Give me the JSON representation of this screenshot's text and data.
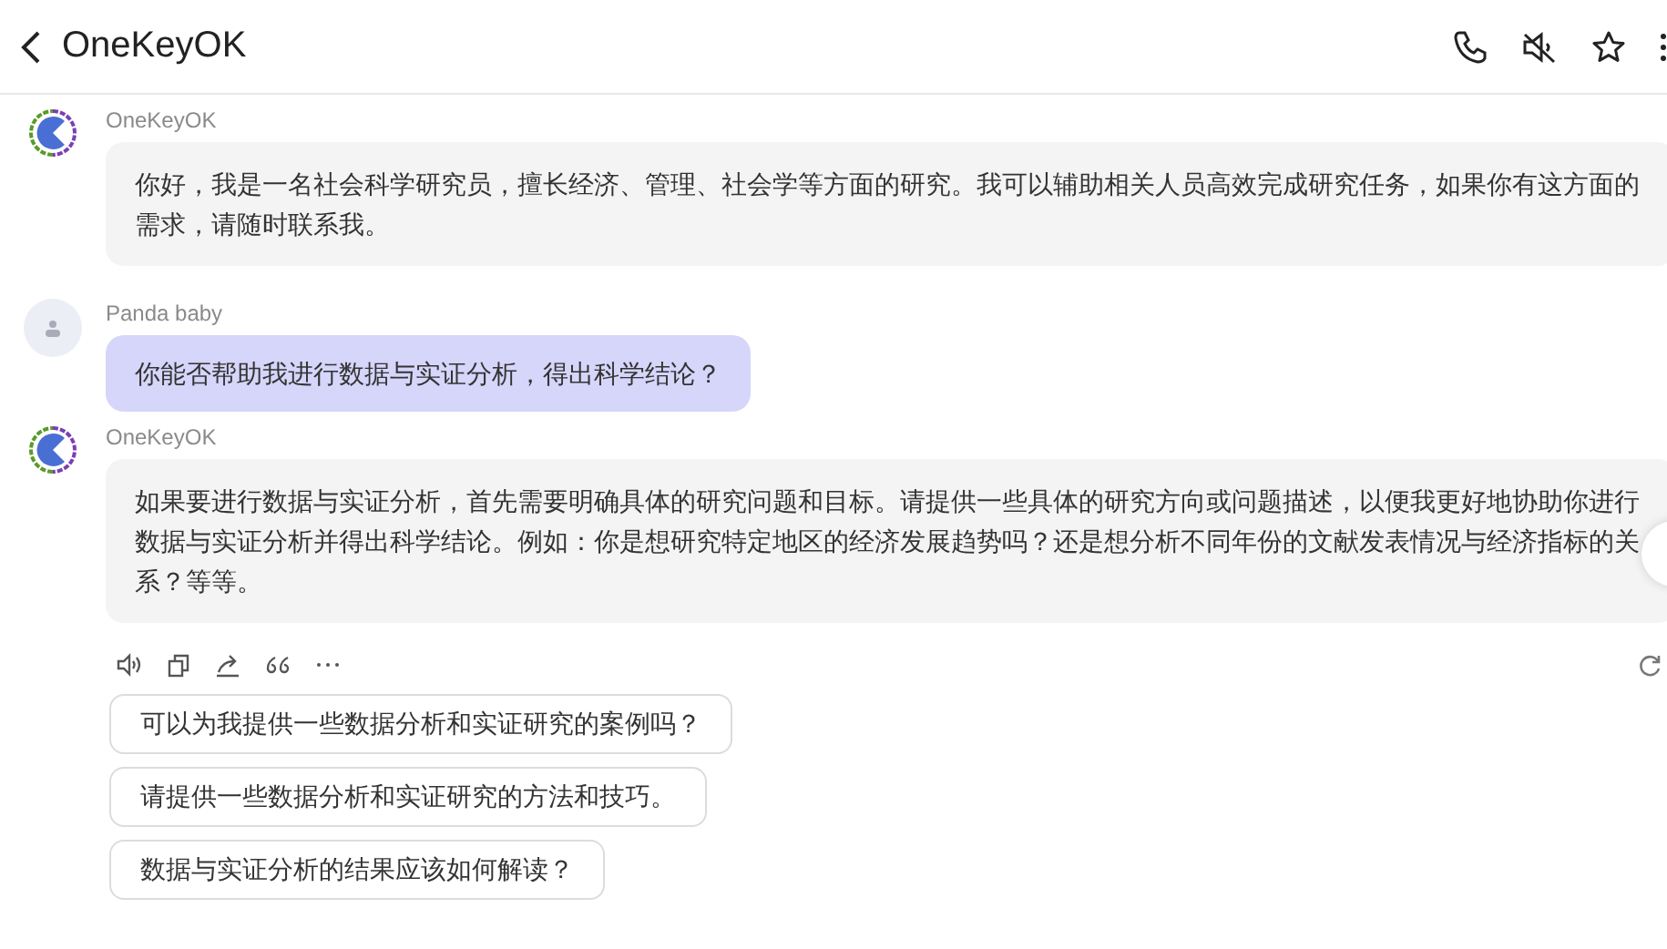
{
  "header": {
    "title": "OneKeyOK"
  },
  "messages": [
    {
      "kind": "bot",
      "sender": "OneKeyOK",
      "text": "你好，我是一名社会科学研究员，擅长经济、管理、社会学等方面的研究。我可以辅助相关人员高效完成研究任务，如果你有这方面的需求，请随时联系我。"
    },
    {
      "kind": "user",
      "sender": "Panda baby",
      "text": "你能否帮助我进行数据与实证分析，得出科学结论？"
    },
    {
      "kind": "bot",
      "sender": "OneKeyOK",
      "text": "如果要进行数据与实证分析，首先需要明确具体的研究问题和目标。请提供一些具体的研究方向或问题描述，以便我更好地协助你进行数据与实证分析并得出科学结论。例如：你是想研究特定地区的经济发展趋势吗？还是想分析不同年份的文献发表情况与经济指标的关系？等等。"
    }
  ],
  "suggestions": [
    "可以为我提供一些数据分析和实证研究的案例吗？",
    "请提供一些数据分析和实证研究的方法和技巧。",
    "数据与实证分析的结果应该如何解读？"
  ]
}
